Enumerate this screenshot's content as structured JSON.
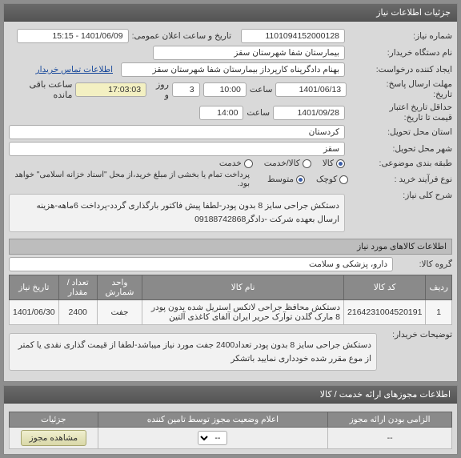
{
  "panel_title": "جزئیات اطلاعات نیاز",
  "need_no_label": "شماره نیاز:",
  "need_no": "1101094152000128",
  "pub_label": "تاریخ و ساعت اعلان عمومی:",
  "pub_val": "1401/06/09 - 15:15",
  "buyer_label": "نام دستگاه خریدار:",
  "buyer_val": "بیمارستان شفا شهرستان سقز",
  "creator_label": "ایجاد کننده درخواست:",
  "creator_val": "بهنام دادگرپناه کارپرداز بیمارستان شفا شهرستان سقز",
  "contact_link": "اطلاعات تماس خریدار",
  "deadline_label": "مهلت ارسال پاسخ:",
  "deadline_history_label": "تاریخ:",
  "deadline_date": "1401/06/13",
  "deadline_hour_lbl": "ساعت",
  "deadline_hour": "10:00",
  "remain_days": "3",
  "days_lbl": "روز و",
  "remain_time": "17:03:03",
  "remain_lbl": "ساعت باقی مانده",
  "min_label": "حداقل تاریخ اعتبار",
  "min_label2": "قیمت تا تاریخ:",
  "min_date": "1401/09/28",
  "min_hour": "14:00",
  "province_label": "استان محل تحویل:",
  "province_val": "کردستان",
  "city_label": "شهر محل تحویل:",
  "city_val": "سقز",
  "class_label": "طبقه بندی موضوعی:",
  "class_o1": "کالا",
  "class_o2": "کالا/خدمت",
  "class_o3": "خدمت",
  "proc_label": "نوع فرآیند خرید :",
  "proc_o1": "کوچک",
  "proc_o2": "متوسط",
  "pay_note": "پرداخت تمام یا بخشی از مبلغ خرید،از محل \"اسناد خزانه اسلامی\" خواهد بود.",
  "desc_label": "شرح کلی نیاز:",
  "desc_text": "دستکش جراحی سایز 8 بدون پودر-لطفا پیش فاکتور بارگذاری گردد-پرداخت 6ماهه-هزینه ارسال بعهده شرکت -دادگر09188742868",
  "items_header": "اطلاعات کالاهای مورد نیاز",
  "group_label": "گروه کالا:",
  "group_val": "دارو، پزشکی و سلامت",
  "col_row": "ردیف",
  "col_code": "کد کالا",
  "col_name": "نام کالا",
  "col_unit": "واحد شمارش",
  "col_qty": "تعداد / مقدار",
  "col_date": "تاریخ نیاز",
  "row1_idx": "1",
  "row1_code": "2164231004520191",
  "row1_name": "دستکش محافظ جراحی لاتکس استریل شده بدون پودر 8 مارک گلدن توآرک حریر ایران آلفای کاغذی آلتین",
  "row1_unit": "جفت",
  "row1_qty": "2400",
  "row1_date": "1401/06/30",
  "buyer_notes_label": "توضیحات خریدار:",
  "buyer_notes": "دستکش جراحی سایز 8 بدون پودر تعداد2400 جفت مورد نیاز میباشد-لطفا از قیمت گذاری نقدی یا کمتر از موع مقرر شده خودداری نمایید باتشکر",
  "perm_panel": "اطلاعات مجوزهای ارائه خدمت / کالا",
  "col2_1": "الزامی بودن ارائه مجوز",
  "col2_2": "اعلام وضعیت مجوز توسط تامین کننده",
  "col2_3": "جزئیات",
  "btn_view": "مشاهده مجوز",
  "sel_placeholder": "--",
  "mandatory": "--"
}
